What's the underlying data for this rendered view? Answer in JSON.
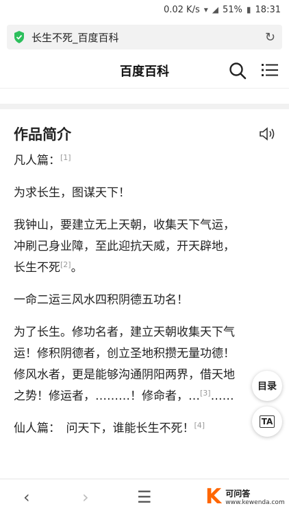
{
  "status": {
    "speed": "0.02 K/s",
    "battery": "51%",
    "time": "18:31"
  },
  "browser": {
    "page_title": "长生不死_百度百科",
    "reload_icon": "↻"
  },
  "header": {
    "title": "百度百科"
  },
  "section": {
    "title": "作品简介"
  },
  "paragraphs": {
    "p1_text": "凡人篇：",
    "p1_ref": "[1]",
    "p2_text": "为求长生，图谋天下！",
    "p3_line1": "我钟山，要建立无上天朝，收集天下气运，",
    "p3_line2": "冲刷己身业障，至此迎抗天威，开天辟地，",
    "p3_line3": "长生不死",
    "p3_ref": "[2]",
    "p3_end": "。",
    "p4_text": "一命二运三风水四积阴德五功名！",
    "p5_line1": "为了长生。修功名者，建立天朝收集天下气",
    "p5_line2": "运！修积阴德者，创立圣地积攒无量功德！",
    "p5_line3": "修风水者，更是能够沟通阴阳两界，借天地",
    "p5_line4a": "之势！修运者，………！修命者，…",
    "p5_ref": "[3]",
    "p5_line4b": "……",
    "p6_text": "仙人篇：　问天下，谁能长生不死！",
    "p6_ref": "[4]"
  },
  "floating": {
    "toc_label": "目录",
    "ta_label": "TA"
  },
  "bottom": {
    "back": "‹",
    "forward": "›",
    "menu": "☰",
    "logo_k": "K",
    "logo_name": "可问答",
    "logo_url": "www.kewenda.com"
  }
}
